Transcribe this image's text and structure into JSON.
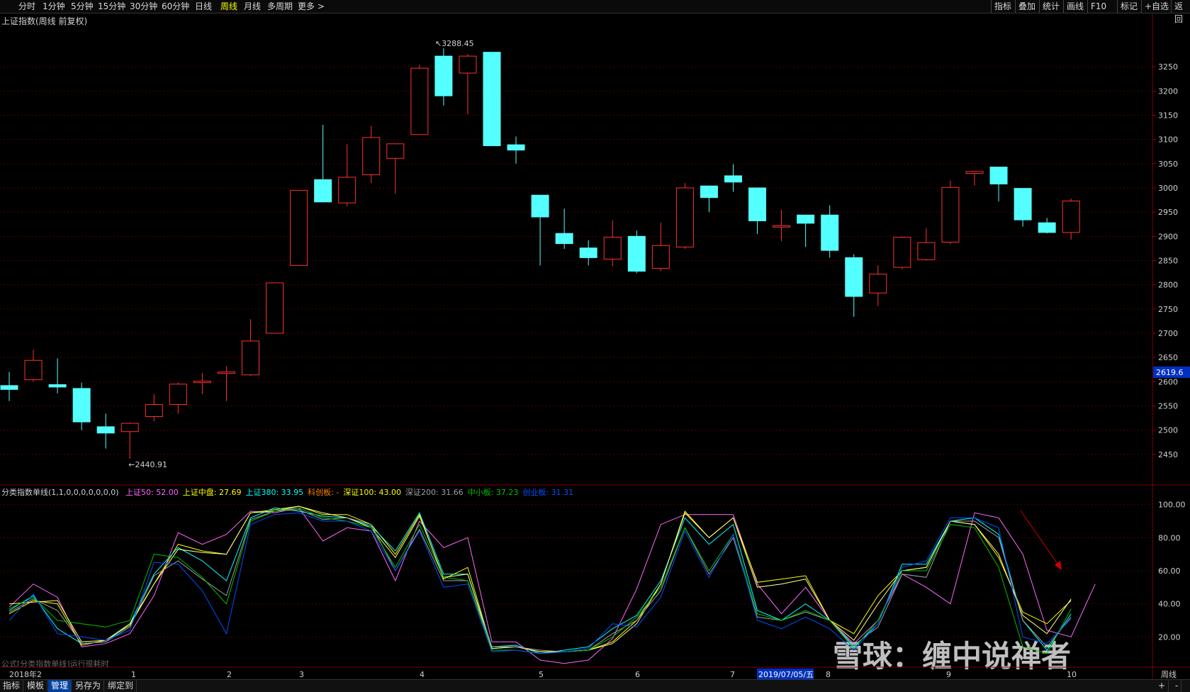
{
  "toolbar": {
    "periods": [
      "分时",
      "1分钟",
      "5分钟",
      "15分钟",
      "30分钟",
      "60分钟",
      "日线",
      "周线",
      "月线",
      "多周期",
      "更多 >"
    ],
    "active": "周线",
    "right": [
      "指标",
      "叠加",
      "统计",
      "画线",
      "F10",
      "标记",
      "+自选",
      "返回"
    ]
  },
  "main_title": "上证指数(周线 前复权)",
  "indicator": {
    "name": "分类指数单线(1,1,0,0,0,0,0,0,0)",
    "items": [
      {
        "label": "上证50: 52.00",
        "color": "#ff66ff"
      },
      {
        "label": "上证中盘: 27.69",
        "color": "#ffff00"
      },
      {
        "label": "上证380: 33.95",
        "color": "#00ffff"
      },
      {
        "label": "科创板: -",
        "color": "#ff8000"
      },
      {
        "label": "深证100: 43.00",
        "color": "#ffff00"
      },
      {
        "label": "深证200: 31.66",
        "color": "#a0a0a0"
      },
      {
        "label": "中小板: 37.23",
        "color": "#00c000"
      },
      {
        "label": "创业板: 31.31",
        "color": "#0050ff"
      }
    ]
  },
  "formula_note": "公式[分类指数单线]运行很耗时",
  "bottom_bar": [
    "指标",
    "模板",
    "管理",
    "另存为",
    "绑定到"
  ],
  "bottom_active": "管理",
  "bottom_right": [
    "+",
    "-"
  ],
  "watermark": "雪球：缠中说禅者",
  "chart_data": [
    {
      "type": "candlestick",
      "title": "上证指数(周线 前复权)",
      "ylim": [
        2400,
        3300
      ],
      "y_ticks": [
        2450,
        2500,
        2550,
        2600,
        2650,
        2700,
        2750,
        2800,
        2850,
        2900,
        2950,
        3000,
        3050,
        3100,
        3150,
        3200,
        3250
      ],
      "annotations": {
        "high": "3288.45",
        "low": "2440.91",
        "current_price": "2619.6"
      },
      "colors": {
        "up": "#ff3030",
        "down": "#54ffff"
      },
      "candles": [
        {
          "o": 2592,
          "c": 2584,
          "h": 2620,
          "l": 2560
        },
        {
          "o": 2604,
          "c": 2644,
          "h": 2666,
          "l": 2600
        },
        {
          "o": 2594,
          "c": 2589,
          "h": 2648,
          "l": 2576
        },
        {
          "o": 2586,
          "c": 2517,
          "h": 2598,
          "l": 2500
        },
        {
          "o": 2507,
          "c": 2494,
          "h": 2534,
          "l": 2462
        },
        {
          "o": 2497,
          "c": 2514,
          "h": 2516,
          "l": 2441
        },
        {
          "o": 2528,
          "c": 2553,
          "h": 2574,
          "l": 2518
        },
        {
          "o": 2553,
          "c": 2595,
          "h": 2598,
          "l": 2534
        },
        {
          "o": 2598,
          "c": 2601,
          "h": 2618,
          "l": 2574
        },
        {
          "o": 2617,
          "c": 2620,
          "h": 2632,
          "l": 2560
        },
        {
          "o": 2614,
          "c": 2684,
          "h": 2729,
          "l": 2612
        },
        {
          "o": 2700,
          "c": 2804,
          "h": 2804,
          "l": 2700
        },
        {
          "o": 2840,
          "c": 2995,
          "h": 2995,
          "l": 2840
        },
        {
          "o": 3017,
          "c": 2971,
          "h": 3130,
          "l": 2971
        },
        {
          "o": 2969,
          "c": 3022,
          "h": 3090,
          "l": 2962
        },
        {
          "o": 3027,
          "c": 3104,
          "h": 3128,
          "l": 3010
        },
        {
          "o": 3061,
          "c": 3091,
          "h": 3091,
          "l": 2988
        },
        {
          "o": 3110,
          "c": 3247,
          "h": 3254,
          "l": 3110
        },
        {
          "o": 3272,
          "c": 3190,
          "h": 3288,
          "l": 3170
        },
        {
          "o": 3237,
          "c": 3272,
          "h": 3276,
          "l": 3152
        },
        {
          "o": 3280,
          "c": 3087,
          "h": 3280,
          "l": 3087
        },
        {
          "o": 3089,
          "c": 3078,
          "h": 3106,
          "l": 3050
        },
        {
          "o": 2985,
          "c": 2940,
          "h": 2985,
          "l": 2840
        },
        {
          "o": 2906,
          "c": 2885,
          "h": 2957,
          "l": 2874
        },
        {
          "o": 2876,
          "c": 2856,
          "h": 2892,
          "l": 2840
        },
        {
          "o": 2853,
          "c": 2898,
          "h": 2933,
          "l": 2838
        },
        {
          "o": 2900,
          "c": 2828,
          "h": 2912,
          "l": 2824
        },
        {
          "o": 2834,
          "c": 2881,
          "h": 2928,
          "l": 2828
        },
        {
          "o": 2878,
          "c": 3000,
          "h": 3010,
          "l": 2874
        },
        {
          "o": 3004,
          "c": 2980,
          "h": 3005,
          "l": 2950
        },
        {
          "o": 3025,
          "c": 3012,
          "h": 3049,
          "l": 2992
        },
        {
          "o": 3000,
          "c": 2932,
          "h": 3000,
          "l": 2905
        },
        {
          "o": 2922,
          "c": 2922,
          "h": 2955,
          "l": 2890
        },
        {
          "o": 2944,
          "c": 2927,
          "h": 2944,
          "l": 2878
        },
        {
          "o": 2944,
          "c": 2871,
          "h": 2964,
          "l": 2856
        },
        {
          "o": 2856,
          "c": 2776,
          "h": 2863,
          "l": 2734
        },
        {
          "o": 2783,
          "c": 2822,
          "h": 2840,
          "l": 2756
        },
        {
          "o": 2836,
          "c": 2898,
          "h": 2900,
          "l": 2832
        },
        {
          "o": 2852,
          "c": 2887,
          "h": 2917,
          "l": 2850
        },
        {
          "o": 2888,
          "c": 3001,
          "h": 3015,
          "l": 2884
        },
        {
          "o": 3030,
          "c": 3034,
          "h": 3035,
          "l": 3005
        },
        {
          "o": 3043,
          "c": 3008,
          "h": 3043,
          "l": 2972
        },
        {
          "o": 2999,
          "c": 2934,
          "h": 2999,
          "l": 2920
        },
        {
          "o": 2928,
          "c": 2908,
          "h": 2938,
          "l": 2906
        },
        {
          "o": 2908,
          "c": 2973,
          "h": 2978,
          "l": 2893
        }
      ]
    },
    {
      "type": "line",
      "title": "分类指数单线(1,1,0,0,0,0,0,0,0)",
      "ylim": [
        0,
        105
      ],
      "y_ticks": [
        20,
        40,
        60,
        80,
        100
      ],
      "x_labels": [
        "2018年",
        "2",
        "1",
        "2",
        "3",
        "4",
        "5",
        "6",
        "7",
        "2019/07/05/五",
        "8",
        "9",
        "10"
      ],
      "period_label": "周线",
      "series": [
        {
          "name": "上证50",
          "color": "#ff66ff",
          "values": [
            38,
            52,
            44,
            14,
            16,
            22,
            45,
            83,
            76,
            82,
            96,
            95,
            98,
            78,
            86,
            84,
            54,
            90,
            74,
            80,
            17,
            17,
            6,
            4,
            6,
            19,
            49,
            88,
            94,
            94,
            94,
            52,
            34,
            50,
            30,
            16,
            30,
            58,
            50,
            40,
            95,
            92,
            70,
            24,
            20,
            52
          ]
        },
        {
          "name": "上证中盘",
          "color": "#ffff00",
          "values": [
            34,
            42,
            40,
            15,
            18,
            27,
            52,
            76,
            72,
            70,
            95,
            97,
            99,
            94,
            94,
            88,
            70,
            94,
            55,
            62,
            13,
            14,
            11,
            11,
            12,
            17,
            30,
            52,
            96,
            80,
            92,
            53,
            55,
            57,
            30,
            22,
            45,
            60,
            62,
            90,
            88,
            68,
            35,
            28,
            42
          ]
        },
        {
          "name": "上证380",
          "color": "#00ffff",
          "values": [
            36,
            45,
            25,
            16,
            17,
            28,
            58,
            74,
            66,
            54,
            92,
            98,
            96,
            93,
            92,
            87,
            72,
            95,
            58,
            58,
            14,
            15,
            10,
            12,
            14,
            25,
            33,
            54,
            92,
            76,
            88,
            36,
            30,
            40,
            30,
            14,
            28,
            64,
            64,
            90,
            92,
            82,
            30,
            12,
            34
          ]
        },
        {
          "name": "深证100",
          "color": "#ffff80",
          "values": [
            40,
            41,
            42,
            17,
            18,
            28,
            52,
            73,
            71,
            70,
            95,
            96,
            99,
            95,
            92,
            86,
            68,
            93,
            56,
            58,
            13,
            14,
            11,
            11,
            12,
            16,
            28,
            52,
            95,
            80,
            92,
            50,
            52,
            55,
            30,
            18,
            40,
            60,
            62,
            90,
            88,
            70,
            33,
            22,
            43
          ]
        },
        {
          "name": "深证200",
          "color": "#a0a0a0",
          "values": [
            35,
            43,
            36,
            16,
            17,
            26,
            57,
            66,
            55,
            45,
            91,
            96,
            97,
            91,
            92,
            88,
            60,
            85,
            54,
            54,
            14,
            14,
            12,
            11,
            12,
            22,
            30,
            48,
            86,
            58,
            80,
            32,
            30,
            35,
            30,
            15,
            26,
            58,
            56,
            90,
            90,
            80,
            30,
            14,
            32
          ]
        },
        {
          "name": "中小板",
          "color": "#00c000",
          "values": [
            37,
            44,
            30,
            28,
            26,
            30,
            70,
            68,
            56,
            40,
            90,
            96,
            98,
            92,
            90,
            86,
            62,
            88,
            56,
            54,
            12,
            12,
            10,
            11,
            12,
            20,
            32,
            50,
            86,
            60,
            82,
            34,
            30,
            36,
            30,
            13,
            30,
            60,
            60,
            88,
            86,
            62,
            14,
            10,
            37
          ]
        },
        {
          "name": "创业板",
          "color": "#0050ff",
          "values": [
            30,
            46,
            22,
            20,
            18,
            24,
            65,
            64,
            48,
            22,
            88,
            94,
            95,
            90,
            90,
            84,
            60,
            84,
            50,
            52,
            11,
            12,
            10,
            11,
            13,
            28,
            26,
            44,
            84,
            56,
            82,
            30,
            25,
            32,
            25,
            12,
            28,
            62,
            66,
            92,
            92,
            86,
            20,
            16,
            31
          ]
        }
      ]
    }
  ]
}
